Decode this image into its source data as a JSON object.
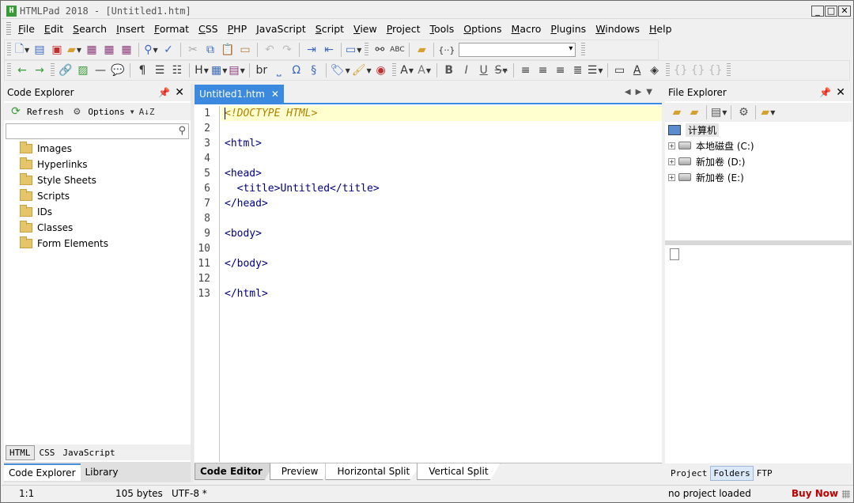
{
  "window": {
    "title": "HTMLPad 2018 - [Untitled1.htm]",
    "icon_letter": "H"
  },
  "menu": [
    "File",
    "Edit",
    "Search",
    "Insert",
    "Format",
    "CSS",
    "PHP",
    "JavaScript",
    "Script",
    "View",
    "Project",
    "Tools",
    "Options",
    "Macro",
    "Plugins",
    "Windows",
    "Help"
  ],
  "toolbar": {
    "heading_label": "H",
    "break_label": "br"
  },
  "code_explorer": {
    "title": "Code Explorer",
    "refresh_label": "Refresh",
    "options_label": "Options",
    "search_placeholder": "",
    "items": [
      "Images",
      "Hyperlinks",
      "Style Sheets",
      "Scripts",
      "IDs",
      "Classes",
      "Form Elements"
    ],
    "lang_tabs": [
      "HTML",
      "CSS",
      "JavaScript"
    ],
    "panel_tabs": [
      "Code Explorer",
      "Library"
    ]
  },
  "editor": {
    "tab_label": "Untitled1.htm",
    "lines": [
      {
        "n": "1",
        "text": "<!DOCTYPE HTML>"
      },
      {
        "n": "2",
        "text": ""
      },
      {
        "n": "3",
        "text": "<html>"
      },
      {
        "n": "4",
        "text": ""
      },
      {
        "n": "5",
        "text": "<head>"
      },
      {
        "n": "6",
        "text": "  <title>Untitled</title>"
      },
      {
        "n": "7",
        "text": "</head>"
      },
      {
        "n": "8",
        "text": ""
      },
      {
        "n": "9",
        "text": "<body>"
      },
      {
        "n": "10",
        "text": ""
      },
      {
        "n": "11",
        "text": "</body>"
      },
      {
        "n": "12",
        "text": ""
      },
      {
        "n": "13",
        "text": "</html>"
      }
    ],
    "view_tabs": [
      "Code Editor",
      "Preview",
      "Horizontal Split",
      "Vertical Split"
    ]
  },
  "file_explorer": {
    "title": "File Explorer",
    "root": "计算机",
    "drives": [
      "本地磁盘 (C:)",
      "新加卷 (D:)",
      "新加卷 (E:)"
    ],
    "bottom_tabs": [
      "Project",
      "Folders",
      "FTP"
    ]
  },
  "status": {
    "position": "1:1",
    "size": "105 bytes",
    "encoding": "UTF-8 *",
    "project": "no project loaded",
    "buy_now": "Buy Now"
  },
  "colors": {
    "accent": "#3c8ae0",
    "buy_now": "#c00000",
    "doctype": "#b08000",
    "tag": "#00007f"
  }
}
